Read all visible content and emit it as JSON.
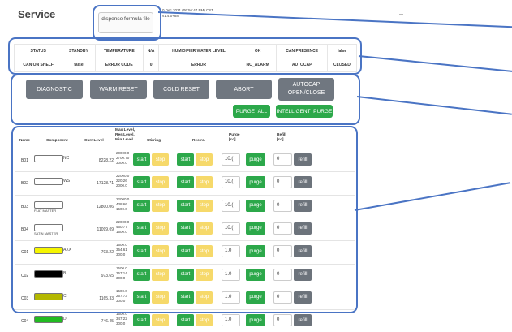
{
  "page": {
    "title": "Service",
    "dispense_btn_label": "dispense formula file",
    "header_info_line1": "0 Dec 2021 (06:56:47 PM) CST",
    "header_info_line2": "v1.4.0+88"
  },
  "status": {
    "row1": [
      {
        "label": "STATUS",
        "value": "STANDBY"
      },
      {
        "label": "TEMPERATURE",
        "value": "N/A"
      },
      {
        "label": "HUMIDIFIER WATER LEVEL",
        "value": "OK"
      },
      {
        "label": "CAN PRESENCE",
        "value": "false"
      }
    ],
    "row2": [
      {
        "label": "CAN ON SHELF",
        "value": "false"
      },
      {
        "label": "ERROR CODE",
        "value": "0"
      },
      {
        "label": "ERROR",
        "value": "NO_ALARM"
      },
      {
        "label": "AUTOCAP",
        "value": "CLOSED"
      }
    ],
    "colors": {
      "standby": "#b8860b",
      "ok": "#2e9e2e",
      "false": "#dd2222",
      "closed": "#2e9e2e"
    }
  },
  "controls": {
    "diagnostic": "DIAGNOSTIC",
    "warm_reset": "WARM RESET",
    "cold_reset": "COLD RESET",
    "abort": "ABORT",
    "autocap_line1": "AUTOCAP",
    "autocap_line2": "OPEN/CLOSE",
    "purge_all": "PURGE_ALL",
    "intelligent_purge": "INTELLIGENT_PURGE"
  },
  "table": {
    "headers": {
      "name": "Name",
      "component": "Component",
      "curr_level": "Curr Level",
      "levels_1": "Max Level,",
      "levels_2": "Res Level,",
      "levels_3": "Min Level",
      "stirring": "Stirring",
      "recirc": "Recirc.",
      "purge_1": "Purge",
      "purge_2": "[cc]",
      "refill_1": "Refill",
      "refill_2": "[cc]"
    },
    "buttons": {
      "start": "start",
      "stop": "stop",
      "purge": "purge",
      "refill": "refill"
    },
    "rows": [
      {
        "name": "B01",
        "component": "NC",
        "sub": "",
        "swatch": "#ffffff",
        "curr": "8228.22",
        "max": "20000.0",
        "res": "2700.70",
        "min": "3000.0",
        "purge": "10.(",
        "refill": "0"
      },
      {
        "name": "B02",
        "component": "WS",
        "sub": "",
        "swatch": "#ffffff",
        "curr": "17128.71",
        "max": "22000.0",
        "res": "220.26",
        "min": "2000.0",
        "purge": "10.(",
        "refill": "0"
      },
      {
        "name": "B03",
        "component": "",
        "sub": "FLAT MASTER",
        "swatch": "#ffffff",
        "curr": "12800.06",
        "max": "22000.0",
        "res": "438.66",
        "min": "1500.0",
        "purge": "10.(",
        "refill": "0"
      },
      {
        "name": "B04",
        "component": "",
        "sub": "SATIN MASTER",
        "swatch": "#ffffff",
        "curr": "11099.09",
        "max": "22000.0",
        "res": "460.77",
        "min": "1500.0",
        "purge": "10.(",
        "refill": "0"
      },
      {
        "name": "C01",
        "component": "AXX",
        "sub": "",
        "swatch": "#f5f500",
        "curr": "703.22",
        "max": "1500.0",
        "res": "354.61",
        "min": "300.0",
        "purge": "1.0",
        "refill": "0"
      },
      {
        "name": "C02",
        "component": "B",
        "sub": "",
        "swatch": "#000000",
        "curr": "973.65",
        "max": "1500.0",
        "res": "357.14",
        "min": "300.0",
        "purge": "1.0",
        "refill": "0"
      },
      {
        "name": "C03",
        "component": "C",
        "sub": "",
        "swatch": "#b4b800",
        "curr": "1165.33",
        "max": "1500.0",
        "res": "257.73",
        "min": "300.0",
        "purge": "1.0",
        "refill": "0"
      },
      {
        "name": "C04",
        "component": "D",
        "sub": "",
        "swatch": "#22bb22",
        "curr": "746.45",
        "max": "1500.0",
        "res": "347.22",
        "min": "300.0",
        "purge": "1.0",
        "refill": "0"
      }
    ]
  }
}
